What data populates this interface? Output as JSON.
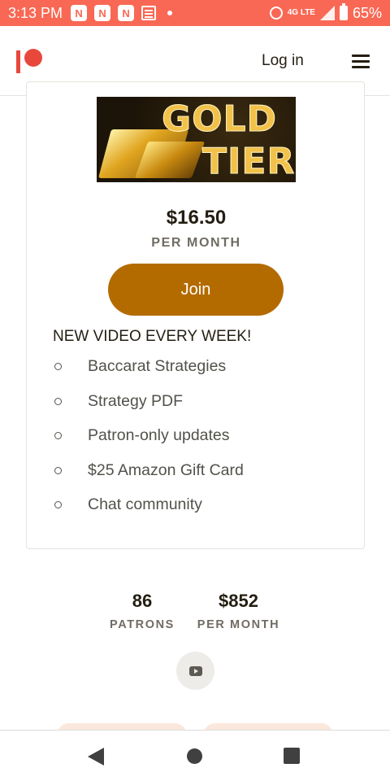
{
  "status_bar": {
    "time": "3:13 PM",
    "notifications": [
      "app-notification-icon",
      "app-notification-icon",
      "app-notification-icon",
      "news-icon"
    ],
    "network": "4G LTE",
    "battery": "65%"
  },
  "header": {
    "logo": "patreon-logo",
    "login_label": "Log in",
    "menu_icon": "hamburger-menu-icon"
  },
  "tier": {
    "image_text_line1": "GOLD",
    "image_text_line2": "TIER",
    "price": "$16.50",
    "period": "PER MONTH",
    "join_label": "Join",
    "headline": "NEW VIDEO EVERY WEEK!",
    "benefits": [
      "Baccarat Strategies",
      "Strategy PDF",
      "Patron-only updates",
      "$25 Amazon Gift Card",
      "Chat community"
    ]
  },
  "stats": {
    "patrons_count": "86",
    "patrons_label": "PATRONS",
    "earnings": "$852",
    "earnings_label": "PER MONTH"
  },
  "social": {
    "youtube_icon": "youtube-icon"
  },
  "colors": {
    "status_bar": "#f96854",
    "logo": "#e8473c",
    "join_button": "#b36b00",
    "text_primary": "#241e12",
    "text_secondary": "#706c64"
  }
}
